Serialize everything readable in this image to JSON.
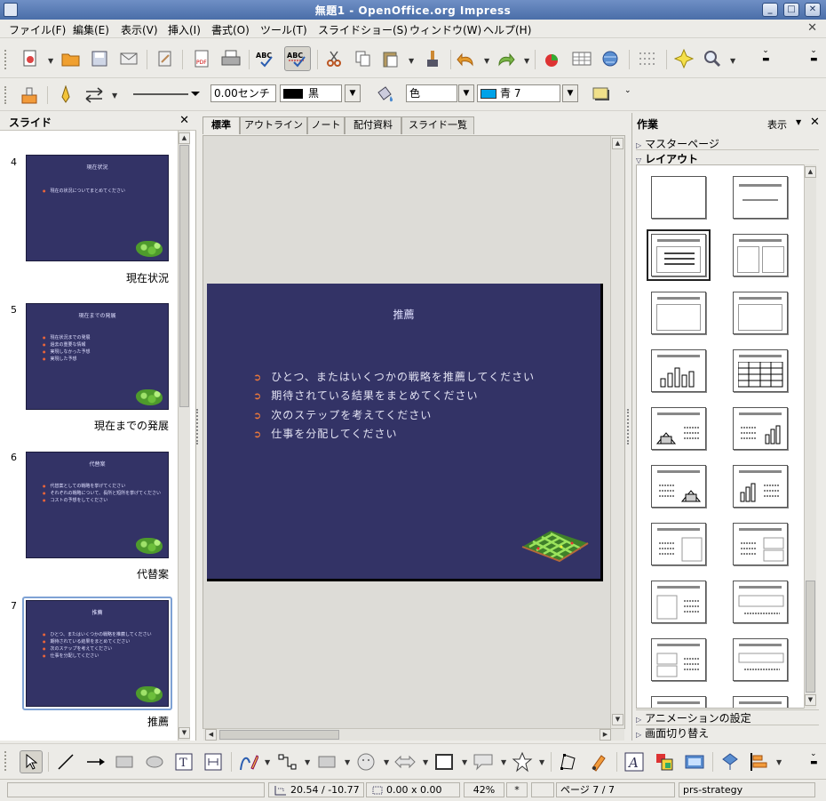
{
  "window": {
    "title": "無題1 - OpenOffice.org Impress",
    "close_doc": "✕"
  },
  "menu": [
    "ファイル(F)",
    "編集(E)",
    "表示(V)",
    "挿入(I)",
    "書式(O)",
    "ツール(T)",
    "スライドショー(S)",
    "ウィンドウ(W)",
    "ヘルプ(H)"
  ],
  "format_toolbar": {
    "line_width": "0.00センチ",
    "line_color": "黒",
    "area_mode": "色",
    "area_color": "青 7",
    "colors": {
      "line": "#000000",
      "area": "#00a2e8"
    }
  },
  "slide_pane": {
    "title": "スライド",
    "close": "✕",
    "slides": [
      {
        "num": "4",
        "name": "現在状況",
        "thumb_title": "現在状況",
        "bullets": [
          "現在の状況についてまとめてください"
        ]
      },
      {
        "num": "5",
        "name": "現在までの発展",
        "thumb_title": "現在までの発展",
        "bullets": [
          "現在状況までの発展",
          "過去の重要な情報",
          "実現しなかった予想",
          "実現した予想"
        ]
      },
      {
        "num": "6",
        "name": "代替案",
        "thumb_title": "代替案",
        "bullets": [
          "代替案としての戦略を挙げてください",
          "それぞれの戦略について、長所と短所を挙げてください",
          "コストの予想をしてください"
        ]
      },
      {
        "num": "7",
        "name": "推薦",
        "thumb_title": "推薦",
        "bullets": [
          "ひとつ、またはいくつかの戦略を推薦してください",
          "期待されている結果をまとめてください",
          "次のステップを考えてください",
          "仕事を分配してください"
        ]
      }
    ]
  },
  "view_tabs": [
    "標準",
    "アウトライン",
    "ノート",
    "配付資料",
    "スライド一覧"
  ],
  "current_slide": {
    "title": "推薦",
    "bullets": [
      "ひとつ、またはいくつかの戦略を推薦してください",
      "期待されている結果をまとめてください",
      "次のステップを考えてください",
      "仕事を分配してください"
    ]
  },
  "task_pane": {
    "title": "作業",
    "view_menu": "表示",
    "close": "✕",
    "sections": {
      "master": "マスターページ",
      "layout": "レイアウト",
      "animation": "アニメーションの設定",
      "transition": "画面切り替え"
    }
  },
  "status": {
    "position": "20.54 / -10.77",
    "size": "0.00 x 0.00",
    "zoom": "42%",
    "modified": "*",
    "page": "ページ 7 / 7",
    "master": "prs-strategy"
  }
}
